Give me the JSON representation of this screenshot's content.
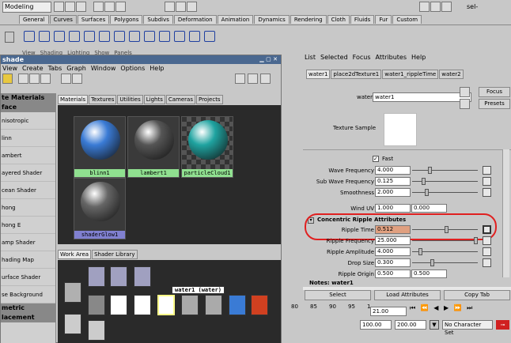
{
  "main": {
    "mode": "Modeling",
    "shelf_tabs": [
      "General",
      "Curves",
      "Surfaces",
      "Polygons",
      "Subdivs",
      "Deformation",
      "Animation",
      "Dynamics",
      "Rendering",
      "Cloth",
      "Fluids",
      "Fur",
      "Custom"
    ],
    "selected_tab": "Curves",
    "menu_partial": [
      "View",
      "Shading",
      "Lighting",
      "Show",
      "Panels"
    ],
    "sel_label": "sel-"
  },
  "hypershade": {
    "title": "shade",
    "menu": [
      "View",
      "Create",
      "Tabs",
      "Graph",
      "Window",
      "Options",
      "Help"
    ],
    "left_items": [
      "te Materials",
      "face",
      "nisotropic",
      "linn",
      "ambert",
      "ayered Shader",
      "cean Shader",
      "hong",
      "hong E",
      "amp Shader",
      "hading Map",
      "urface Shader",
      "se Background",
      "metric",
      "lacement"
    ],
    "tabs": [
      "Materials",
      "Textures",
      "Utilities",
      "Lights",
      "Cameras",
      "Projects"
    ],
    "swatches": [
      {
        "name": "blinn1",
        "color": "#3a7bd5"
      },
      {
        "name": "lambert1",
        "color": "#555555"
      },
      {
        "name": "particleCloud1",
        "color": "#1fa3a0"
      },
      {
        "name": "shaderGlow1",
        "color": "#666666"
      }
    ],
    "work_tabs": [
      "Work Area",
      "Shader Library"
    ],
    "tooltip": "water1 (water)"
  },
  "ae": {
    "menu": [
      "List",
      "Selected",
      "Focus",
      "Attributes",
      "Help"
    ],
    "tabs": [
      "water1",
      "place2dTexture1",
      "water1_rippleTime",
      "water2"
    ],
    "node_label": "water:",
    "node_name": "water1",
    "focus": "Focus",
    "presets": "Presets",
    "texture_sample": "Texture Sample",
    "fast": "Fast",
    "attrs": [
      {
        "label": "Wave Frequency",
        "value": "4.000",
        "pos": 0.25
      },
      {
        "label": "Sub Wave Frequency",
        "value": "0.125",
        "pos": 0.15
      },
      {
        "label": "Smoothness",
        "value": "2.000",
        "pos": 0.2
      }
    ],
    "wind_uv": {
      "label": "Wind UV",
      "u": "1.000",
      "v": "0.000"
    },
    "section": "Concentric Ripple Attributes",
    "ripple": [
      {
        "label": "Ripple Time",
        "value": "0.512",
        "pos": 0.52,
        "hl": true
      },
      {
        "label": "Ripple Frequency",
        "value": "25.000",
        "pos": 1.0
      },
      {
        "label": "Ripple Amplitude",
        "value": "4.000",
        "pos": 0.1
      },
      {
        "label": "Drop Size",
        "value": "0.300",
        "pos": 0.3
      },
      {
        "label": "Ripple Origin",
        "value": "0.500",
        "v": "0.500"
      }
    ],
    "notes": "Notes: water1",
    "buttons": [
      "Select",
      "Load Attributes",
      "Copy Tab"
    ]
  },
  "timeline": {
    "ticks": [
      "80",
      "85",
      "90",
      "95",
      "1"
    ],
    "current": "21.00",
    "range_start": "100.00",
    "range_end": "200.00",
    "charset": "No Character Set"
  },
  "colors": {
    "title": "#4a6890",
    "highlight": "#e0a080",
    "red_circle": "#e02020"
  }
}
